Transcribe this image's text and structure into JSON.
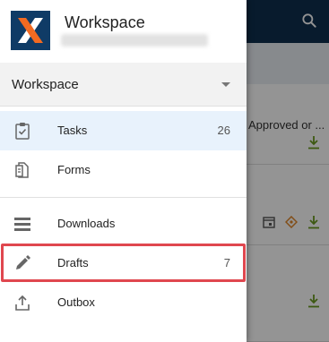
{
  "background": {
    "toolbar_color": "#0f2f4f",
    "search_icon": "search-icon",
    "cards": [
      {
        "text": "Approved or ..."
      },
      {
        "text": ""
      },
      {
        "text": ""
      }
    ]
  },
  "drawer": {
    "logo_icon": "workspace-logo-icon",
    "title": "Workspace",
    "workspace_selector": {
      "value": "Workspace"
    },
    "items": [
      {
        "label": "Tasks",
        "count": "26",
        "icon": "clipboard-check-icon",
        "active": true
      },
      {
        "label": "Forms",
        "count": "",
        "icon": "form-document-icon",
        "active": false
      },
      {
        "label": "Downloads",
        "count": "",
        "icon": "list-downloads-icon",
        "active": false
      },
      {
        "label": "Drafts",
        "count": "7",
        "icon": "pencil-icon",
        "active": false,
        "highlighted": true
      },
      {
        "label": "Outbox",
        "count": "",
        "icon": "upload-outbox-icon",
        "active": false
      }
    ]
  },
  "colors": {
    "accent": "#0f3b66",
    "logo_orange": "#f26a21",
    "active_bg": "#e8f2fc",
    "highlight_border": "#e0474f",
    "download_green": "#6a9a1f"
  }
}
